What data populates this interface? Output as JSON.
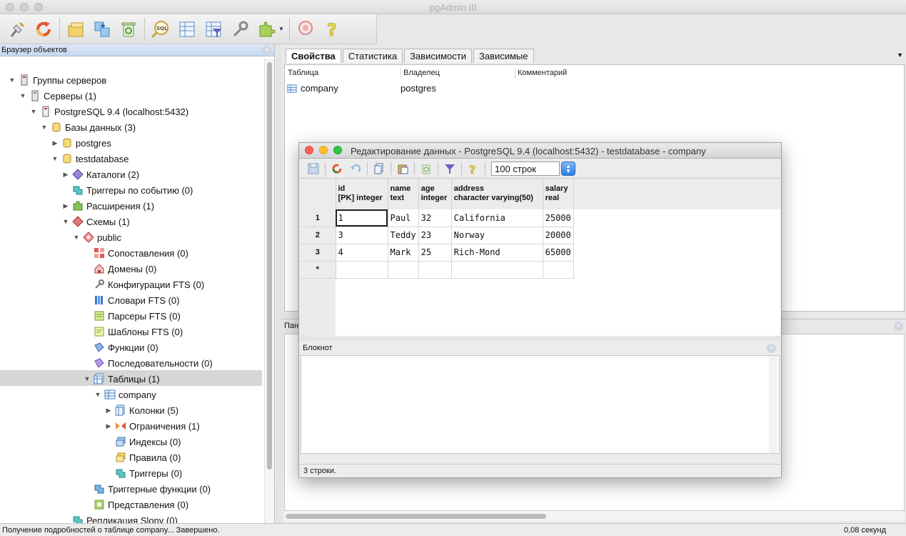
{
  "app": {
    "title": "pgAdmin III"
  },
  "toolbar": {
    "icons": [
      "connect-icon",
      "refresh-icon",
      "properties-icon",
      "create-icon",
      "drop-icon",
      "sql-query-icon",
      "view-data-icon",
      "view-filtered-data-icon",
      "maintenance-icon",
      "plugins-icon",
      "hint-icon",
      "help-icon"
    ]
  },
  "browser": {
    "header": "Браузер объектов",
    "nodes": [
      {
        "label": "Группы серверов"
      },
      {
        "label": "Серверы (1)"
      },
      {
        "label": "PostgreSQL 9.4 (localhost:5432)"
      },
      {
        "label": "Базы данных (3)"
      },
      {
        "label": "postgres"
      },
      {
        "label": "testdatabase"
      },
      {
        "label": "Каталоги (2)"
      },
      {
        "label": "Триггеры по событию (0)"
      },
      {
        "label": "Расширения (1)"
      },
      {
        "label": "Схемы (1)"
      },
      {
        "label": "public"
      },
      {
        "label": "Сопоставления (0)"
      },
      {
        "label": "Домены (0)"
      },
      {
        "label": "Конфигурации FTS (0)"
      },
      {
        "label": "Словари FTS (0)"
      },
      {
        "label": "Парсеры FTS (0)"
      },
      {
        "label": "Шаблоны FTS (0)"
      },
      {
        "label": "Функции (0)"
      },
      {
        "label": "Последовательности (0)"
      },
      {
        "label": "Таблицы (1)"
      },
      {
        "label": "company"
      },
      {
        "label": "Колонки (5)"
      },
      {
        "label": "Ограничения (1)"
      },
      {
        "label": "Индексы (0)"
      },
      {
        "label": "Правила (0)"
      },
      {
        "label": "Триггеры (0)"
      },
      {
        "label": "Триггерные функции (0)"
      },
      {
        "label": "Представления (0)"
      },
      {
        "label": "Репликация Slony (0)"
      }
    ]
  },
  "properties": {
    "tabs": [
      "Свойства",
      "Статистика",
      "Зависимости",
      "Зависимые"
    ],
    "columns": [
      "Таблица",
      "Владелец",
      "Комментарий"
    ],
    "row": {
      "table": "company",
      "owner": "postgres",
      "comment": ""
    }
  },
  "sql_panel": {
    "header": "Пан"
  },
  "status": {
    "message": "Получение подробностей о таблице company... Завершено.",
    "time": "0,08 секунд"
  },
  "edit_window": {
    "title": "Редактирование данных - PostgreSQL 9.4 (localhost:5432) - testdatabase - company",
    "rows_limit": "100 строк",
    "columns": [
      {
        "name": "id",
        "type": "[PK] integer"
      },
      {
        "name": "name",
        "type": "text"
      },
      {
        "name": "age",
        "type": "integer"
      },
      {
        "name": "address",
        "type": "character varying(50)"
      },
      {
        "name": "salary",
        "type": "real"
      }
    ],
    "rows": [
      {
        "num": "1",
        "cells": [
          "1",
          "Paul",
          "32",
          "California",
          "25000"
        ]
      },
      {
        "num": "2",
        "cells": [
          "3",
          "Teddy",
          "23",
          "Norway",
          "20000"
        ]
      },
      {
        "num": "3",
        "cells": [
          "4",
          "Mark",
          "25",
          "Rich-Mond",
          "65000"
        ]
      },
      {
        "num": "*",
        "cells": [
          "",
          "",
          "",
          "",
          ""
        ]
      }
    ],
    "notepad_header": "Блокнот",
    "status": "3 строки."
  }
}
